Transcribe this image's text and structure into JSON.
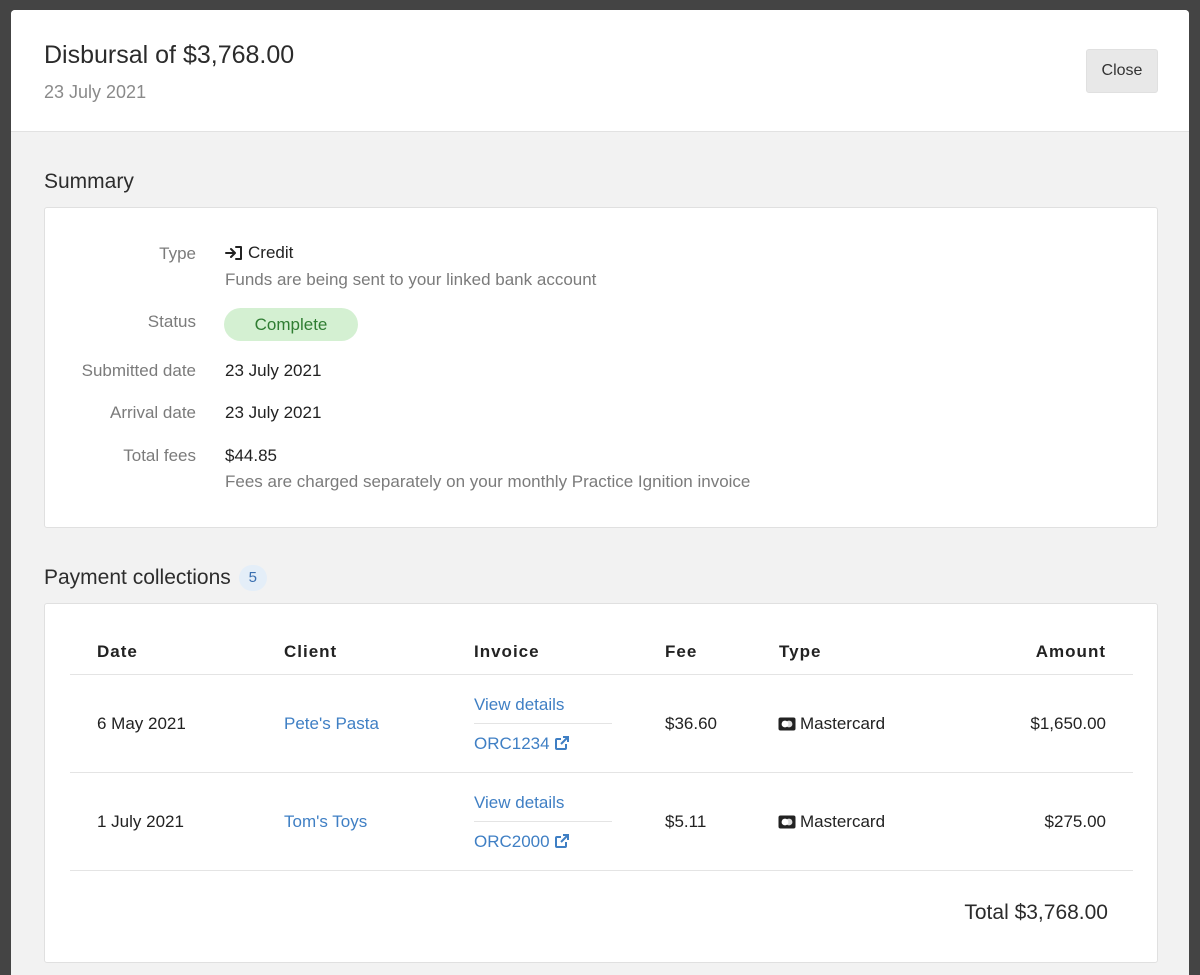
{
  "header": {
    "title": "Disbursal of $3,768.00",
    "subtitle": "23 July 2021",
    "close_label": "Close"
  },
  "summary": {
    "section_title": "Summary",
    "type_label": "Type",
    "type_value": "Credit",
    "type_desc": "Funds are being sent to your linked bank account",
    "status_label": "Status",
    "status_value": "Complete",
    "submitted_label": "Submitted date",
    "submitted_value": "23 July 2021",
    "arrival_label": "Arrival date",
    "arrival_value": "23 July 2021",
    "fees_label": "Total fees",
    "fees_value": "$44.85",
    "fees_desc": "Fees are charged separately on your monthly Practice Ignition invoice"
  },
  "payments": {
    "section_title": "Payment collections",
    "count": "5",
    "columns": [
      "Date",
      "Client",
      "Invoice",
      "Fee",
      "Type",
      "Amount"
    ],
    "rows": [
      {
        "date": "6 May 2021",
        "client": "Pete's Pasta",
        "view_details": "View details",
        "invoice": "ORC1234",
        "fee": "$36.60",
        "type": "Mastercard",
        "amount": "$1,650.00"
      },
      {
        "date": "1 July 2021",
        "client": "Tom's Toys",
        "view_details": "View details",
        "invoice": "ORC2000",
        "fee": "$5.11",
        "type": "Mastercard",
        "amount": "$275.00"
      }
    ],
    "total": "Total $3,768.00"
  },
  "icons": {
    "credit": "sign-in-arrow-icon",
    "external": "external-link-icon",
    "card": "credit-card-icon"
  },
  "colors": {
    "link": "#3f7fc4",
    "status_bg": "#d4f0d2",
    "status_text": "#2f7d32",
    "badge_bg": "#e4eef8"
  }
}
